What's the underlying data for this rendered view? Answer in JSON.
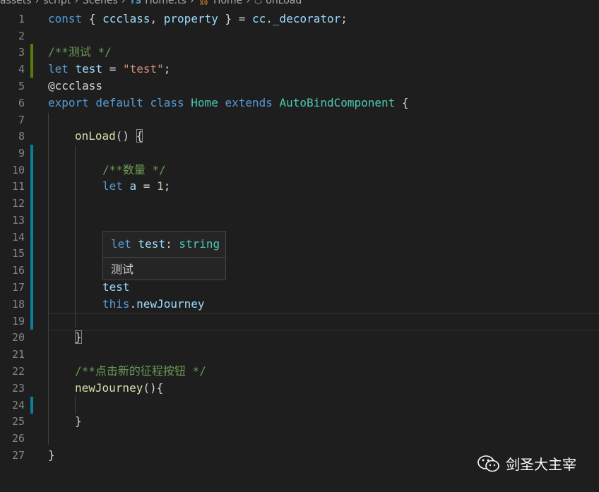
{
  "breadcrumb": {
    "items": [
      "assets",
      "script",
      "Scenes",
      "Home.ts",
      "Home",
      "onLoad"
    ],
    "ts_icon_label": "TS"
  },
  "editor": {
    "line_numbers": [
      "1",
      "2",
      "3",
      "4",
      "5",
      "6",
      "7",
      "8",
      "9",
      "10",
      "11",
      "12",
      "13",
      "14",
      "15",
      "16",
      "17",
      "18",
      "19",
      "20",
      "21",
      "22",
      "23",
      "24",
      "25",
      "26",
      "27"
    ],
    "lines": {
      "l1": {
        "const": "const",
        "open": " { ",
        "ccclass": "ccclass",
        "comma": ", ",
        "property": "property",
        "close": " } = ",
        "cc": "cc",
        "dot": ".",
        "decorator": "_decorator",
        "semi": ";"
      },
      "l3": {
        "comment": "/**测试 */"
      },
      "l4": {
        "let": "let",
        "name": " test",
        "eq": " = ",
        "value": "\"test\"",
        "semi": ";"
      },
      "l5": {
        "decorator": "@ccclass"
      },
      "l6": {
        "export": "export",
        "default": " default",
        "class": " class",
        "name": " Home",
        "extends": " extends",
        "base": " AutoBindComponent",
        "brace": " {"
      },
      "l8": {
        "method": "onLoad",
        "parens": "()",
        "space": " ",
        "brace": "{"
      },
      "l10": {
        "comment": "/**数量 */"
      },
      "l11": {
        "let": "let",
        "name": " a",
        "eq": " = ",
        "value": "1",
        "semi": ";"
      },
      "l17": {
        "ident": "test"
      },
      "l18": {
        "this": "this",
        "dot": ".",
        "member": "newJourney"
      },
      "l20": {
        "brace": "}"
      },
      "l22": {
        "comment": "/**点击新的征程按钮 */"
      },
      "l23": {
        "method": "newJourney",
        "rest": "(){"
      },
      "l25": {
        "brace": "}"
      },
      "l27": {
        "brace": "}"
      }
    }
  },
  "hover": {
    "keyword": "let",
    "name": " test",
    "colon": ": ",
    "type": "string",
    "doc": "测试"
  },
  "watermark": {
    "text": "剑圣大主宰"
  },
  "colors": {
    "background": "#1e1e1e",
    "keyword": "#569cd6",
    "variable": "#9cdcfe",
    "class": "#4ec9b0",
    "function": "#dcdcaa",
    "string": "#ce9178",
    "number": "#b5cea8",
    "comment": "#6a9955",
    "gutter_added": "#587c0c",
    "gutter_modified": "#0c7d9d"
  }
}
